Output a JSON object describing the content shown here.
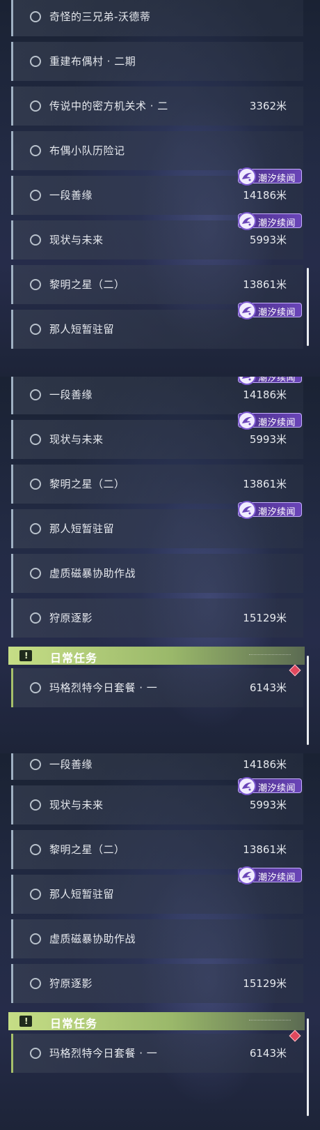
{
  "badge_label": "潮汐续闻",
  "daily_header": "日常任务",
  "colors": {
    "badge": "#5b3aa6",
    "daily_accent": "#b5cf78",
    "diamond": "#e0485e"
  },
  "panel1": {
    "rows": [
      {
        "title": "奇怪的三兄弟-沃德蒂",
        "distance": "",
        "badge": false
      },
      {
        "title": "重建布偶村 · 二期",
        "distance": "",
        "badge": false
      },
      {
        "title": "传说中的密方机关术 · 二",
        "distance": "3362米",
        "badge": false
      },
      {
        "title": "布偶小队历险记",
        "distance": "",
        "badge": false
      },
      {
        "title": "一段善缘",
        "distance": "14186米",
        "badge": true
      },
      {
        "title": "现状与未来",
        "distance": "5993米",
        "badge": true
      },
      {
        "title": "黎明之星（二）",
        "distance": "13861米",
        "badge": false
      },
      {
        "title": "那人短暂驻留",
        "distance": "",
        "badge": true
      }
    ]
  },
  "panel2": {
    "rows": [
      {
        "title": "一段善缘",
        "distance": "14186米",
        "badge": true
      },
      {
        "title": "现状与未来",
        "distance": "5993米",
        "badge": true
      },
      {
        "title": "黎明之星（二）",
        "distance": "13861米",
        "badge": false
      },
      {
        "title": "那人短暂驻留",
        "distance": "",
        "badge": true
      },
      {
        "title": "虚质磁暴协助作战",
        "distance": "",
        "badge": false
      },
      {
        "title": "狩原逐影",
        "distance": "15129米",
        "badge": false
      }
    ],
    "daily": {
      "title": "玛格烈特今日套餐 · 一",
      "distance": "6143米"
    }
  },
  "panel3": {
    "rows": [
      {
        "title": "一段善缘",
        "distance": "14186米",
        "badge": false
      },
      {
        "title": "现状与未来",
        "distance": "5993米",
        "badge": true
      },
      {
        "title": "黎明之星（二）",
        "distance": "13861米",
        "badge": false
      },
      {
        "title": "那人短暂驻留",
        "distance": "",
        "badge": true
      },
      {
        "title": "虚质磁暴协助作战",
        "distance": "",
        "badge": false
      },
      {
        "title": "狩原逐影",
        "distance": "15129米",
        "badge": false
      }
    ],
    "daily": {
      "title": "玛格烈特今日套餐 · 一",
      "distance": "6143米"
    }
  }
}
